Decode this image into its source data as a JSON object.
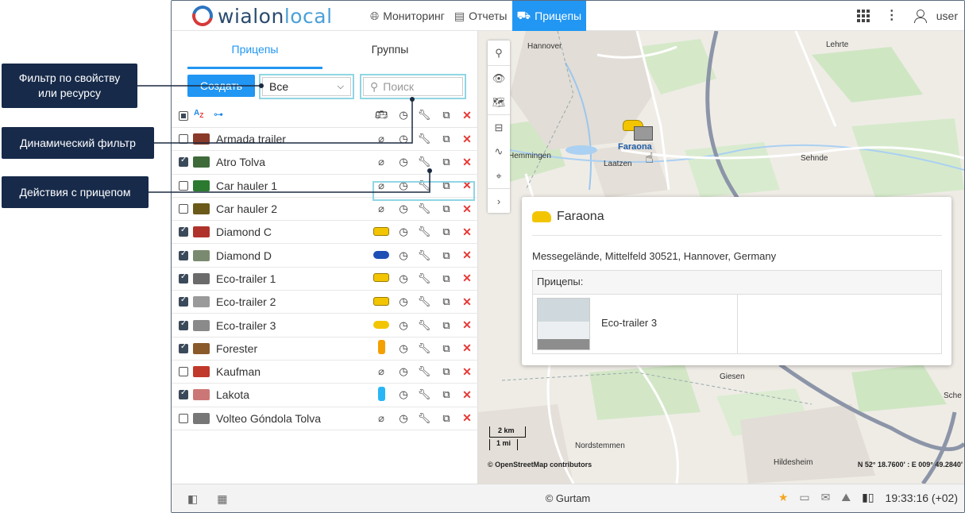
{
  "logo": {
    "text_main": "wialon",
    "text_accent": "local"
  },
  "nav": [
    {
      "label": "Мониторинг",
      "icon": "globe-icon"
    },
    {
      "label": "Отчеты",
      "icon": "report-icon"
    },
    {
      "label": "Прицепы",
      "icon": "trailer-icon",
      "active": true
    }
  ],
  "topbar": {
    "user": "user"
  },
  "panel": {
    "tabs": [
      {
        "label": "Прицепы",
        "active": true
      },
      {
        "label": "Группы"
      }
    ],
    "create_label": "Создать",
    "filter_value": "Все",
    "search_placeholder": "Поиск"
  },
  "trailers": [
    {
      "name": "Armada trailer",
      "checked": false,
      "thumb_color": "#8b3a2a",
      "unit": "unlink"
    },
    {
      "name": "Atro Tolva",
      "checked": true,
      "thumb_color": "#3f6b3a",
      "unit": "unlink"
    },
    {
      "name": "Car hauler 1",
      "checked": false,
      "thumb_color": "#2b7a2f",
      "unit": "unlink"
    },
    {
      "name": "Car hauler 2",
      "checked": false,
      "thumb_color": "#6b5a1a",
      "unit": "unlink"
    },
    {
      "name": "Diamond C",
      "checked": true,
      "thumb_color": "#b0332b",
      "unit": "yellow-bus"
    },
    {
      "name": "Diamond D",
      "checked": true,
      "thumb_color": "#7a8a70",
      "unit": "blue-car"
    },
    {
      "name": "Eco-trailer 1",
      "checked": true,
      "thumb_color": "#6b6b6b",
      "unit": "yellow-bus"
    },
    {
      "name": "Eco-trailer 2",
      "checked": true,
      "thumb_color": "#9a9a9a",
      "unit": "yellow-bus"
    },
    {
      "name": "Eco-trailer 3",
      "checked": true,
      "thumb_color": "#8a8a8a",
      "unit": "yellow-car"
    },
    {
      "name": "Forester",
      "checked": true,
      "thumb_color": "#8a5a2a",
      "unit": "yellow-vertical"
    },
    {
      "name": "Kaufman",
      "checked": false,
      "thumb_color": "#c0392b",
      "unit": "unlink"
    },
    {
      "name": "Lakota",
      "checked": true,
      "thumb_color": "#c77",
      "unit": "cyan-vertical"
    },
    {
      "name": "Volteo Góndola Tolva",
      "checked": false,
      "thumb_color": "#777",
      "unit": "unlink"
    }
  ],
  "map": {
    "places": [
      {
        "name": "Hannover"
      },
      {
        "name": "Lehrte"
      },
      {
        "name": "Hemmingen"
      },
      {
        "name": "Laatzen"
      },
      {
        "name": "Sehnde"
      },
      {
        "name": "Giesen"
      },
      {
        "name": "Nordstemmen"
      },
      {
        "name": "Hildesheim"
      },
      {
        "name": "Sche"
      }
    ],
    "unit_label": "Faraona",
    "scale_km": "2 km",
    "scale_mi": "1 mi",
    "attribution": "© OpenStreetMap contributors",
    "coords": "N 52° 18.7600' : E 009° 49.2840'"
  },
  "popup": {
    "title": "Faraona",
    "address": "Messegelände, Mittelfeld 30521, Hannover, Germany",
    "table_header": "Прицепы:",
    "trailer_name": "Eco-trailer 3"
  },
  "bottom": {
    "copyright": "© Gurtam",
    "time": "19:33:16 (+02)"
  },
  "callouts": [
    {
      "text": "Фильтр по свойству или ресурсу"
    },
    {
      "text": "Динамический фильтр"
    },
    {
      "text": "Действия с прицепом"
    }
  ],
  "colors": {
    "accent": "#2196f3",
    "callout_bg": "#172a4a",
    "highlight": "#8fd6e4",
    "delete": "#e53935"
  }
}
